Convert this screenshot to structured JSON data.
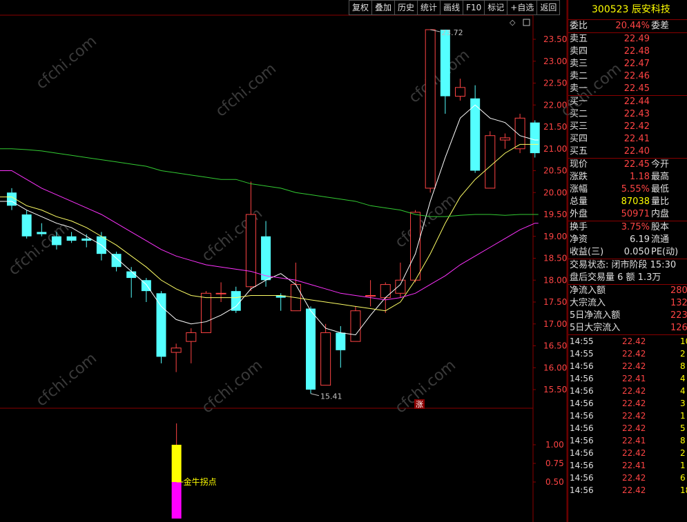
{
  "toolbar": [
    "复权",
    "叠加",
    "历史",
    "统计",
    "画线",
    "F10",
    "标记",
    "+自选",
    "返回"
  ],
  "stock": {
    "code": "300523",
    "name": "辰安科技"
  },
  "price_axis": [
    "23.50",
    "23.00",
    "22.50",
    "22.00",
    "21.50",
    "21.00",
    "20.50",
    "20.00",
    "19.50",
    "19.00",
    "18.50",
    "18.00",
    "17.50",
    "17.00",
    "16.50",
    "16.00",
    "15.50"
  ],
  "indicator_axis": [
    "1.00",
    "0.75",
    "0.50"
  ],
  "annotations": {
    "high": "23.72",
    "low": "15.41",
    "zhang": "涨",
    "signal": "金牛拐点"
  },
  "watermark": "cfchi.com",
  "panel": {
    "weibi": {
      "label": "委比",
      "value": "20.44%",
      "label2": "委差"
    },
    "asks": [
      {
        "label": "卖五",
        "price": "22.49"
      },
      {
        "label": "卖四",
        "price": "22.48"
      },
      {
        "label": "卖三",
        "price": "22.47"
      },
      {
        "label": "卖二",
        "price": "22.46"
      },
      {
        "label": "卖一",
        "price": "22.45"
      }
    ],
    "bids": [
      {
        "label": "买一",
        "price": "22.44"
      },
      {
        "label": "买二",
        "price": "22.43"
      },
      {
        "label": "买三",
        "price": "22.42"
      },
      {
        "label": "买四",
        "price": "22.41"
      },
      {
        "label": "买五",
        "price": "22.40"
      }
    ],
    "quote": [
      {
        "label": "现价",
        "value": "22.45",
        "label2": "今开"
      },
      {
        "label": "涨跌",
        "value": "1.18",
        "label2": "最高"
      },
      {
        "label": "涨幅",
        "value": "5.55%",
        "label2": "最低"
      },
      {
        "label": "总量",
        "value": "87038",
        "label2": "量比"
      },
      {
        "label": "外盘",
        "value": "50971",
        "label2": "内盘"
      }
    ],
    "quote2": [
      {
        "label": "换手",
        "value": "3.75%",
        "label2": "股本"
      },
      {
        "label": "净资",
        "value": "6.19",
        "label2": "流通"
      },
      {
        "label": "收益(三)",
        "value": "0.050",
        "label2": "PE(动)"
      }
    ],
    "status": [
      "交易状态: 闭市阶段 15:30",
      "盘后交易量 6 额 1.3万"
    ],
    "flows": [
      {
        "label": "净流入额",
        "value": "280"
      },
      {
        "label": "大宗流入",
        "value": "132"
      },
      {
        "label": "5日净流入额",
        "value": "223"
      },
      {
        "label": "5日大宗流入",
        "value": "126"
      }
    ],
    "ticks": [
      {
        "t": "14:55",
        "p": "22.42",
        "v": "10"
      },
      {
        "t": "14:55",
        "p": "22.42",
        "v": "2"
      },
      {
        "t": "14:56",
        "p": "22.42",
        "v": "8"
      },
      {
        "t": "14:56",
        "p": "22.41",
        "v": "4"
      },
      {
        "t": "14:56",
        "p": "22.42",
        "v": "4"
      },
      {
        "t": "14:56",
        "p": "22.42",
        "v": "3"
      },
      {
        "t": "14:56",
        "p": "22.42",
        "v": "1"
      },
      {
        "t": "14:56",
        "p": "22.42",
        "v": "5"
      },
      {
        "t": "14:56",
        "p": "22.41",
        "v": "8"
      },
      {
        "t": "14:56",
        "p": "22.42",
        "v": "2"
      },
      {
        "t": "14:56",
        "p": "22.41",
        "v": "1"
      },
      {
        "t": "14:56",
        "p": "22.42",
        "v": "6"
      },
      {
        "t": "14:56",
        "p": "22.42",
        "v": "18"
      }
    ]
  },
  "chart_data": {
    "type": "candlestick",
    "price_range": [
      15.2,
      23.8
    ],
    "candles": [
      {
        "o": 20.0,
        "c": 19.7,
        "h": 20.1,
        "l": 19.6
      },
      {
        "o": 19.5,
        "c": 19.0,
        "h": 19.6,
        "l": 18.95
      },
      {
        "o": 19.1,
        "c": 19.05,
        "h": 19.3,
        "l": 19.0
      },
      {
        "o": 19.0,
        "c": 18.8,
        "h": 19.1,
        "l": 18.7
      },
      {
        "o": 19.0,
        "c": 18.9,
        "h": 19.1,
        "l": 18.85
      },
      {
        "o": 18.95,
        "c": 18.9,
        "h": 19.05,
        "l": 18.75
      },
      {
        "o": 19.0,
        "c": 18.6,
        "h": 19.1,
        "l": 18.45
      },
      {
        "o": 18.6,
        "c": 18.3,
        "h": 18.65,
        "l": 18.2
      },
      {
        "o": 18.2,
        "c": 18.05,
        "h": 18.3,
        "l": 17.6
      },
      {
        "o": 18.0,
        "c": 17.75,
        "h": 18.05,
        "l": 17.5
      },
      {
        "o": 17.7,
        "c": 16.25,
        "h": 17.75,
        "l": 16.1
      },
      {
        "o": 16.35,
        "c": 16.45,
        "h": 16.55,
        "l": 15.9
      },
      {
        "o": 16.6,
        "c": 16.8,
        "h": 16.9,
        "l": 16.1
      },
      {
        "o": 16.8,
        "c": 17.7,
        "h": 17.75,
        "l": 16.8
      },
      {
        "o": 17.7,
        "c": 17.7,
        "h": 17.95,
        "l": 17.5
      },
      {
        "o": 17.75,
        "c": 17.3,
        "h": 17.85,
        "l": 17.25
      },
      {
        "o": 17.85,
        "c": 19.5,
        "h": 20.25,
        "l": 17.75
      },
      {
        "o": 19.0,
        "c": 18.0,
        "h": 19.35,
        "l": 17.85
      },
      {
        "o": 17.65,
        "c": 17.6,
        "h": 17.7,
        "l": 17.3
      },
      {
        "o": 17.3,
        "c": 17.9,
        "h": 18.4,
        "l": 17.3
      },
      {
        "o": 17.35,
        "c": 15.5,
        "h": 17.4,
        "l": 15.41
      },
      {
        "o": 15.6,
        "c": 16.8,
        "h": 17.0,
        "l": 15.6
      },
      {
        "o": 16.8,
        "c": 16.4,
        "h": 16.95,
        "l": 16.0
      },
      {
        "o": 16.6,
        "c": 17.3,
        "h": 17.4,
        "l": 16.6
      },
      {
        "o": 17.65,
        "c": 17.65,
        "h": 18.0,
        "l": 17.4
      },
      {
        "o": 17.6,
        "c": 17.9,
        "h": 17.95,
        "l": 17.25
      },
      {
        "o": 17.7,
        "c": 18.0,
        "h": 18.4,
        "l": 17.6
      },
      {
        "o": 18.0,
        "c": 19.55,
        "h": 19.6,
        "l": 17.95
      },
      {
        "o": 20.1,
        "c": 23.72,
        "h": 23.72,
        "l": 20.0
      },
      {
        "o": 23.72,
        "c": 22.2,
        "h": 23.72,
        "l": 21.8
      },
      {
        "o": 22.2,
        "c": 22.4,
        "h": 22.6,
        "l": 22.1
      },
      {
        "o": 22.15,
        "c": 20.5,
        "h": 22.45,
        "l": 20.45
      },
      {
        "o": 20.1,
        "c": 21.3,
        "h": 21.4,
        "l": 20.1
      },
      {
        "o": 21.2,
        "c": 21.25,
        "h": 21.35,
        "l": 21.0
      },
      {
        "o": 21.0,
        "c": 21.7,
        "h": 21.8,
        "l": 20.9
      },
      {
        "o": 21.6,
        "c": 20.9,
        "h": 21.65,
        "l": 20.8
      }
    ],
    "ma_series": [
      {
        "color": "#ffffff",
        "values": [
          19.8,
          19.6,
          19.45,
          19.3,
          19.2,
          19.0,
          18.8,
          18.5,
          18.2,
          17.9,
          17.4,
          17.1,
          17.0,
          17.05,
          17.2,
          17.4,
          17.8,
          18.0,
          18.15,
          17.9,
          17.3,
          16.9,
          16.8,
          16.75,
          17.2,
          17.6,
          17.9,
          18.6,
          19.8,
          20.8,
          21.7,
          22.0,
          21.7,
          21.6,
          21.3,
          21.2
        ]
      },
      {
        "color": "#ffff66",
        "values": [
          19.9,
          19.7,
          19.6,
          19.45,
          19.35,
          19.2,
          19.0,
          18.8,
          18.55,
          18.3,
          18.0,
          17.8,
          17.65,
          17.6,
          17.6,
          17.6,
          17.65,
          17.65,
          17.65,
          17.6,
          17.55,
          17.5,
          17.45,
          17.4,
          17.35,
          17.3,
          17.5,
          18.0,
          18.6,
          19.3,
          19.9,
          20.3,
          20.6,
          20.9,
          21.1,
          21.1
        ]
      },
      {
        "color": "#ff33ff",
        "values": [
          20.5,
          20.3,
          20.1,
          19.95,
          19.8,
          19.65,
          19.5,
          19.3,
          19.1,
          18.9,
          18.7,
          18.55,
          18.45,
          18.35,
          18.3,
          18.25,
          18.2,
          18.1,
          18.05,
          18.0,
          17.9,
          17.8,
          17.7,
          17.65,
          17.6,
          17.55,
          17.6,
          17.7,
          17.9,
          18.1,
          18.35,
          18.55,
          18.75,
          18.95,
          19.15,
          19.3
        ]
      },
      {
        "color": "#33cc33",
        "values": [
          21.0,
          20.98,
          20.95,
          20.9,
          20.85,
          20.8,
          20.75,
          20.7,
          20.65,
          20.6,
          20.5,
          20.45,
          20.4,
          20.35,
          20.3,
          20.3,
          20.2,
          20.15,
          20.1,
          20.0,
          19.95,
          19.9,
          19.85,
          19.8,
          19.7,
          19.65,
          19.6,
          19.5,
          19.45,
          19.45,
          19.48,
          19.5,
          19.5,
          19.48,
          19.5,
          19.5
        ]
      }
    ],
    "indicator": {
      "range": [
        0,
        1.2
      ],
      "bar": {
        "index": 11,
        "yellow": [
          0.5,
          1.0
        ],
        "magenta": [
          0,
          0.5
        ]
      }
    }
  }
}
